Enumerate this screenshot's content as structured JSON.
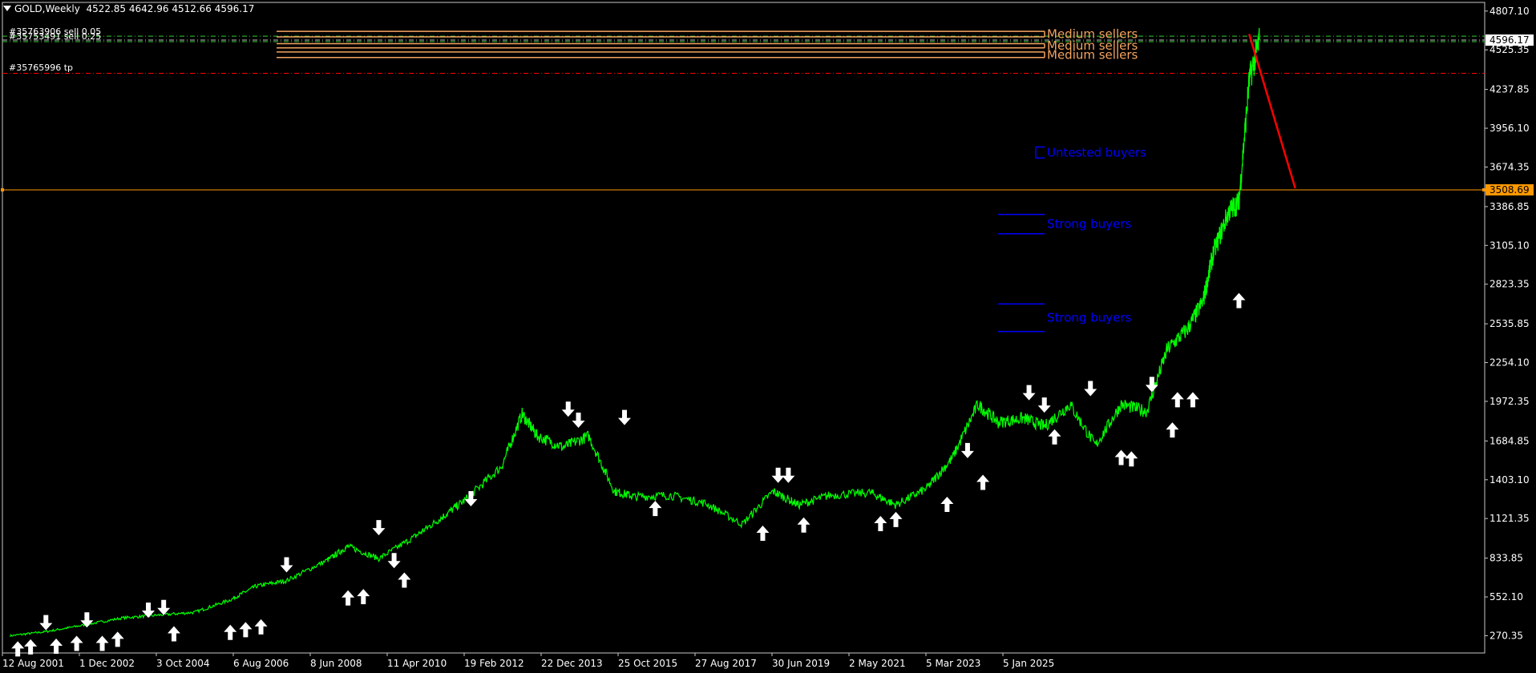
{
  "header": {
    "symbol": "GOLD,Weekly",
    "ohlc": "4522.85 4642.96 4512.66 4596.17"
  },
  "orders": {
    "sell1": "#35763906 sell 0.05",
    "sell2": "#35753491 sell 0.25",
    "tp": "#35765996 tp"
  },
  "colors": {
    "background": "#000000",
    "price_line": "#00ff00",
    "supply": "#f4a460",
    "demand": "#0000ff",
    "current_price": "#ffffff",
    "hline": "#ff9900",
    "tp_line": "#ff0000",
    "trend_line": "#ff0000",
    "trade_lines": "#32cd32"
  },
  "chart_data": {
    "type": "line",
    "title": "GOLD,Weekly",
    "ylim": [
      145,
      4870
    ],
    "y_ticks": [
      "4807.10",
      "4525.35",
      "4237.85",
      "3956.10",
      "3674.35",
      "3386.85",
      "3105.10",
      "2823.35",
      "2535.85",
      "2254.10",
      "1972.35",
      "1684.85",
      "1403.10",
      "1121.35",
      "833.85",
      "552.10",
      "270.35"
    ],
    "x_ticks": [
      "12 Aug 2001",
      "1 Dec 2002",
      "3 Oct 2004",
      "6 Aug 2006",
      "8 Jun 2008",
      "11 Apr 2010",
      "19 Feb 2012",
      "22 Dec 2013",
      "25 Oct 2015",
      "27 Aug 2017",
      "30 Jun 2019",
      "2 May 2021",
      "5 Mar 2023",
      "5 Jan 2025"
    ],
    "series": [
      {
        "x": [
          2001.6,
          2002.3,
          2003.0,
          2003.8,
          2004.5,
          2005.2,
          2005.9,
          2006.4,
          2007.0,
          2007.8,
          2008.2,
          2008.8,
          2009.5,
          2010.0,
          2010.5,
          2011.2,
          2011.6,
          2011.9,
          2012.4,
          2012.9,
          2013.4,
          2013.8,
          2014.5,
          2015.2,
          2015.9,
          2016.5,
          2017.0,
          2017.6,
          2018.4,
          2018.9,
          2019.5,
          2020.0,
          2020.5,
          2020.9,
          2021.4,
          2021.8,
          2022.3,
          2022.8,
          2023.3,
          2023.8,
          2024.2,
          2024.6,
          2024.9,
          2025.1,
          2025.4,
          2025.6,
          2025.8,
          2026.0
        ],
        "values": [
          270,
          300,
          345,
          400,
          420,
          440,
          530,
          630,
          670,
          820,
          920,
          830,
          990,
          1120,
          1260,
          1500,
          1880,
          1720,
          1640,
          1720,
          1320,
          1280,
          1290,
          1230,
          1080,
          1320,
          1220,
          1290,
          1310,
          1220,
          1340,
          1560,
          1950,
          1820,
          1850,
          1790,
          1950,
          1650,
          1950,
          1900,
          2350,
          2500,
          2700,
          3050,
          3350,
          3420,
          4300,
          4596.17
        ]
      }
    ],
    "horizontal_lines": [
      {
        "price": 4596.17,
        "label": "4596.17"
      },
      {
        "price": 3508.69,
        "label": "3508.69"
      },
      {
        "price": 4355,
        "label": "#35765996 tp"
      }
    ],
    "zones": [
      {
        "label": "Medium sellers",
        "price_top": 4660,
        "price_bottom": 4620
      },
      {
        "label": "Medium sellers",
        "price_top": 4570,
        "price_bottom": 4540
      },
      {
        "label": "Medium sellers",
        "price_top": 4510,
        "price_bottom": 4470
      },
      {
        "label": "Untested buyers",
        "price_top": 3820,
        "price_bottom": 3740
      },
      {
        "label": "Strong buyers",
        "price_top": 3330,
        "price_bottom": 3190
      },
      {
        "label": "Strong buyers",
        "price_top": 2680,
        "price_bottom": 2480
      }
    ],
    "trend_line": {
      "x1": 2025.8,
      "y1": 4640,
      "x2": 2026.7,
      "y2": 3520
    },
    "signals": [
      {
        "x": 2001.75,
        "value": 230,
        "dir": "up"
      },
      {
        "x": 2002.0,
        "value": 245,
        "dir": "up"
      },
      {
        "x": 2002.3,
        "value": 310,
        "dir": "down"
      },
      {
        "x": 2002.5,
        "value": 250,
        "dir": "up"
      },
      {
        "x": 2002.9,
        "value": 270,
        "dir": "up"
      },
      {
        "x": 2003.1,
        "value": 330,
        "dir": "down"
      },
      {
        "x": 2003.4,
        "value": 270,
        "dir": "up"
      },
      {
        "x": 2003.7,
        "value": 300,
        "dir": "up"
      },
      {
        "x": 2004.3,
        "value": 400,
        "dir": "down"
      },
      {
        "x": 2004.6,
        "value": 420,
        "dir": "down"
      },
      {
        "x": 2004.8,
        "value": 340,
        "dir": "up"
      },
      {
        "x": 2005.9,
        "value": 350,
        "dir": "up"
      },
      {
        "x": 2006.2,
        "value": 370,
        "dir": "up"
      },
      {
        "x": 2006.5,
        "value": 390,
        "dir": "up"
      },
      {
        "x": 2007.0,
        "value": 730,
        "dir": "down"
      },
      {
        "x": 2008.2,
        "value": 600,
        "dir": "up"
      },
      {
        "x": 2008.5,
        "value": 610,
        "dir": "up"
      },
      {
        "x": 2008.8,
        "value": 1000,
        "dir": "down"
      },
      {
        "x": 2009.1,
        "value": 760,
        "dir": "down"
      },
      {
        "x": 2009.3,
        "value": 730,
        "dir": "up"
      },
      {
        "x": 2010.6,
        "value": 1210,
        "dir": "down"
      },
      {
        "x": 2012.5,
        "value": 1860,
        "dir": "down"
      },
      {
        "x": 2012.7,
        "value": 1780,
        "dir": "down"
      },
      {
        "x": 2013.6,
        "value": 1800,
        "dir": "down"
      },
      {
        "x": 2014.2,
        "value": 1250,
        "dir": "up"
      },
      {
        "x": 2016.3,
        "value": 1070,
        "dir": "up"
      },
      {
        "x": 2016.6,
        "value": 1380,
        "dir": "down"
      },
      {
        "x": 2016.8,
        "value": 1380,
        "dir": "down"
      },
      {
        "x": 2017.1,
        "value": 1130,
        "dir": "up"
      },
      {
        "x": 2018.6,
        "value": 1140,
        "dir": "up"
      },
      {
        "x": 2018.9,
        "value": 1170,
        "dir": "up"
      },
      {
        "x": 2019.9,
        "value": 1280,
        "dir": "up"
      },
      {
        "x": 2020.3,
        "value": 1560,
        "dir": "down"
      },
      {
        "x": 2020.6,
        "value": 1440,
        "dir": "up"
      },
      {
        "x": 2021.5,
        "value": 1980,
        "dir": "down"
      },
      {
        "x": 2021.8,
        "value": 1890,
        "dir": "down"
      },
      {
        "x": 2022.0,
        "value": 1770,
        "dir": "up"
      },
      {
        "x": 2022.7,
        "value": 2010,
        "dir": "down"
      },
      {
        "x": 2023.3,
        "value": 1620,
        "dir": "up"
      },
      {
        "x": 2023.5,
        "value": 1610,
        "dir": "up"
      },
      {
        "x": 2023.9,
        "value": 2040,
        "dir": "down"
      },
      {
        "x": 2024.3,
        "value": 1820,
        "dir": "up"
      },
      {
        "x": 2024.4,
        "value": 2040,
        "dir": "up"
      },
      {
        "x": 2024.7,
        "value": 2040,
        "dir": "up"
      },
      {
        "x": 2025.6,
        "value": 2760,
        "dir": "up"
      }
    ]
  }
}
